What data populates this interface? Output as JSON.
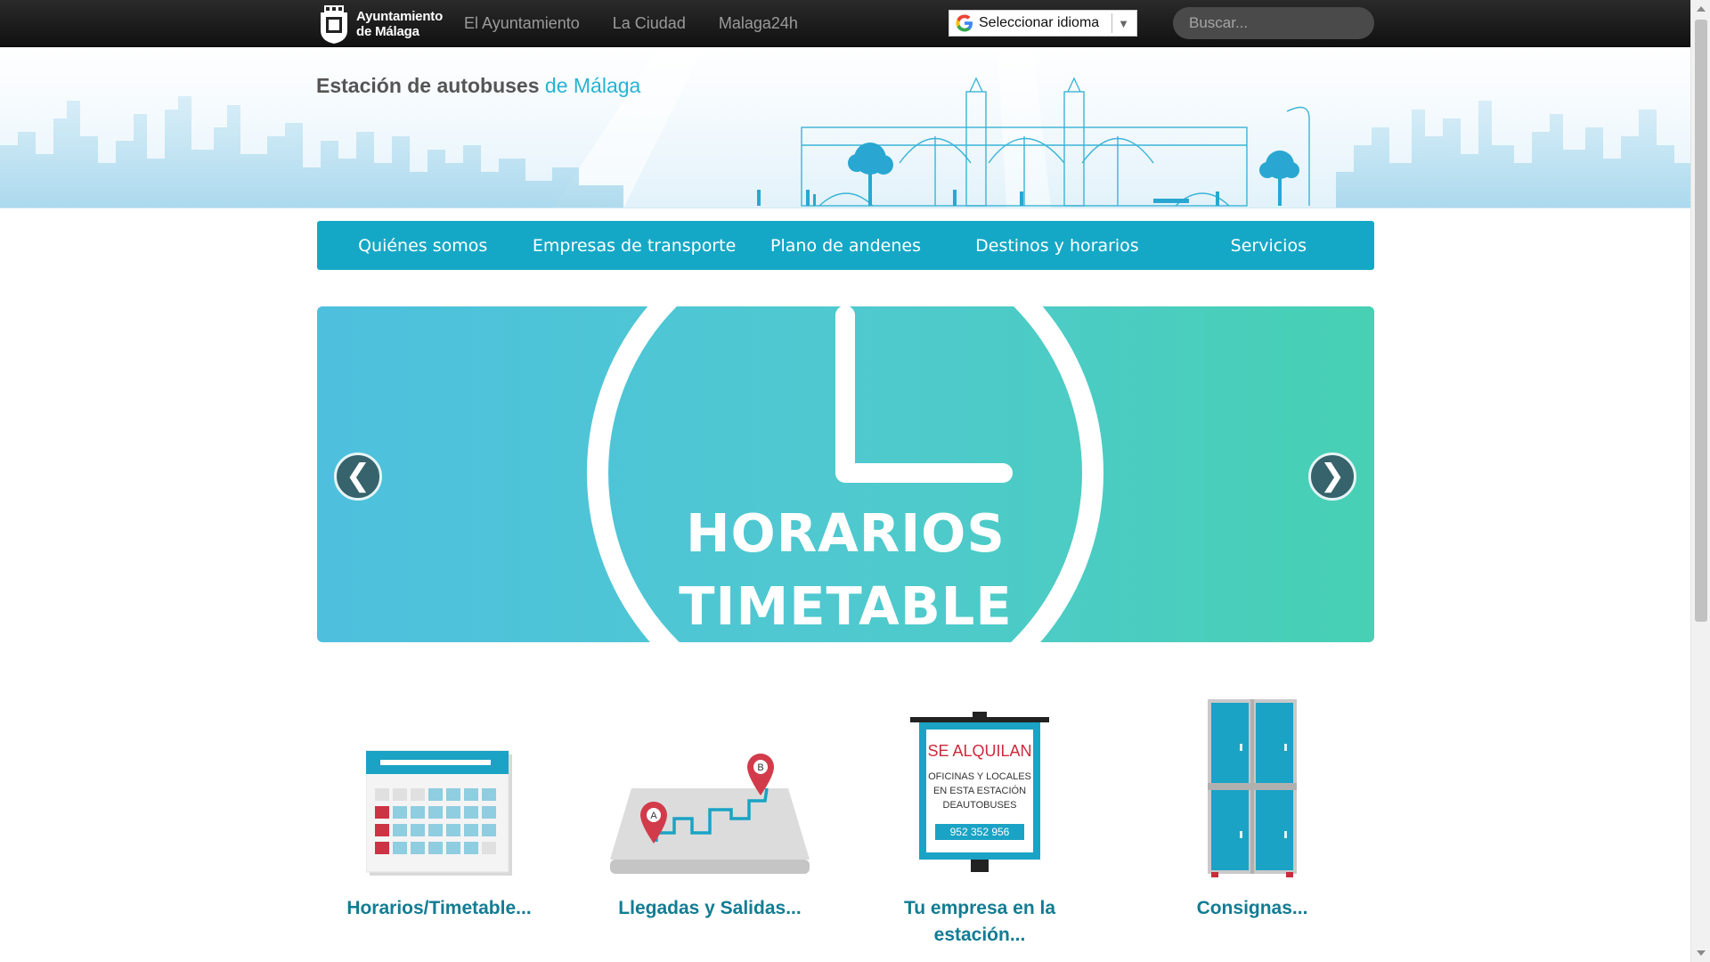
{
  "topbar": {
    "logo_line1": "Ayuntamiento",
    "logo_line2": "de Málaga",
    "nav": [
      "El Ayuntamiento",
      "La Ciudad",
      "Malaga24h"
    ],
    "language_label": "Seleccionar idioma",
    "search_placeholder": "Buscar..."
  },
  "header": {
    "title_main": "Estación de autobuses",
    "title_accent": "de Málaga"
  },
  "main_nav": [
    "Quiénes somos",
    "Empresas de transporte",
    "Plano de andenes",
    "Destinos y horarios",
    "Servicios"
  ],
  "slider": {
    "line1": "HORARIOS",
    "line2": "TIMETABLE",
    "prev_symbol": "❮",
    "next_symbol": "❯"
  },
  "tiles": [
    {
      "label": "Horarios/Timetable...",
      "icon": "calendar-icon"
    },
    {
      "label": "Llegadas y Salidas...",
      "icon": "map-route-icon"
    },
    {
      "label": "Tu empresa en la estación...",
      "icon": "for-rent-sign-icon"
    },
    {
      "label": "Consignas...",
      "icon": "lockers-icon"
    }
  ],
  "rent_sign": {
    "heading": "SE ALQUILAN",
    "line1": "OFICINAS Y LOCALES",
    "line2": "EN ESTA ESTACIÓN",
    "line3": "DEAUTOBUSES",
    "phone": "952 352 956"
  },
  "map_pins": {
    "start": "A",
    "end": "B"
  },
  "colors": {
    "brand": "#15a8c6",
    "accent_text": "#27b3d3",
    "tile_label": "#127c93",
    "topbar": "#1b1b1b"
  }
}
